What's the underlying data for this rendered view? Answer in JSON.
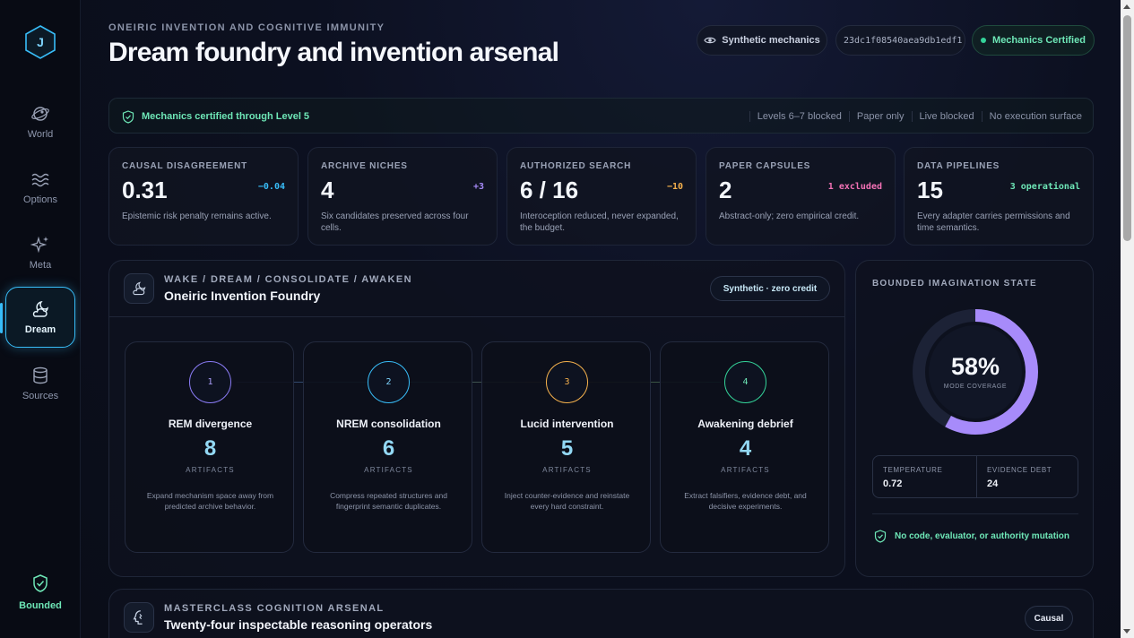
{
  "sidebar": {
    "logo_letter": "J",
    "items": [
      {
        "label": "World",
        "icon": "globe-icon"
      },
      {
        "label": "Options",
        "icon": "waves-icon"
      },
      {
        "label": "Meta",
        "icon": "sparkles-icon"
      },
      {
        "label": "Dream",
        "icon": "moon-cloud-icon",
        "active": true
      },
      {
        "label": "Sources",
        "icon": "database-icon"
      }
    ],
    "footer_label": "Bounded"
  },
  "header": {
    "eyebrow": "ONEIRIC INVENTION AND COGNITIVE IMMUNITY",
    "title": "Dream foundry and invention arsenal",
    "mode_pill": "Synthetic mechanics",
    "hash": "23dc1f08540aea9db1edf1",
    "cert_pill": "Mechanics Certified"
  },
  "banner": {
    "text": "Mechanics certified through Level 5",
    "tags": [
      "Levels 6–7 blocked",
      "Paper only",
      "Live blocked",
      "No execution surface"
    ]
  },
  "stats": [
    {
      "label": "CAUSAL DISAGREEMENT",
      "value": "0.31",
      "delta": "−0.04",
      "delta_color": "#38bdf8",
      "desc": "Epistemic risk penalty remains active."
    },
    {
      "label": "ARCHIVE NICHES",
      "value": "4",
      "delta": "+3",
      "delta_color": "#a78bfa",
      "desc": "Six candidates preserved across four cells."
    },
    {
      "label": "AUTHORIZED SEARCH",
      "value": "6 / 16",
      "delta": "−10",
      "delta_color": "#f5b14c",
      "desc": "Interoception reduced, never expanded, the budget."
    },
    {
      "label": "PAPER CAPSULES",
      "value": "2",
      "delta": "1 excluded",
      "delta_color": "#f472b6",
      "desc": "Abstract-only; zero empirical credit."
    },
    {
      "label": "DATA PIPELINES",
      "value": "15",
      "delta": "3 operational",
      "delta_color": "#6ee7b7",
      "desc": "Every adapter carries permissions and time semantics."
    }
  ],
  "foundry": {
    "eyebrow": "WAKE / DREAM / CONSOLIDATE / AWAKEN",
    "title": "Oneiric Invention Foundry",
    "pill": "Synthetic · zero credit",
    "phases": [
      {
        "num": "1",
        "title": "REM divergence",
        "count": "8",
        "unit": "ARTIFACTS",
        "desc": "Expand mechanism space away from predicted archive behavior.",
        "color": "#8b7cf6"
      },
      {
        "num": "2",
        "title": "NREM consolidation",
        "count": "6",
        "unit": "ARTIFACTS",
        "desc": "Compress repeated structures and fingerprint semantic duplicates.",
        "color": "#38bdf8"
      },
      {
        "num": "3",
        "title": "Lucid intervention",
        "count": "5",
        "unit": "ARTIFACTS",
        "desc": "Inject counter-evidence and reinstate every hard constraint.",
        "color": "#f5b14c"
      },
      {
        "num": "4",
        "title": "Awakening debrief",
        "count": "4",
        "unit": "ARTIFACTS",
        "desc": "Extract falsifiers, evidence debt, and decisive experiments.",
        "color": "#34d399"
      }
    ]
  },
  "imagination": {
    "label": "BOUNDED IMAGINATION STATE",
    "coverage_display": "58%",
    "coverage_fraction": 0.58,
    "coverage_label": "MODE COVERAGE",
    "metrics": [
      {
        "label": "TEMPERATURE",
        "value": "0.72"
      },
      {
        "label": "EVIDENCE DEBT",
        "value": "24"
      }
    ],
    "footer": "No code, evaluator, or authority mutation"
  },
  "arsenal": {
    "eyebrow": "MASTERCLASS COGNITION ARSENAL",
    "title": "Twenty-four inspectable reasoning operators",
    "pill": "Causal"
  }
}
